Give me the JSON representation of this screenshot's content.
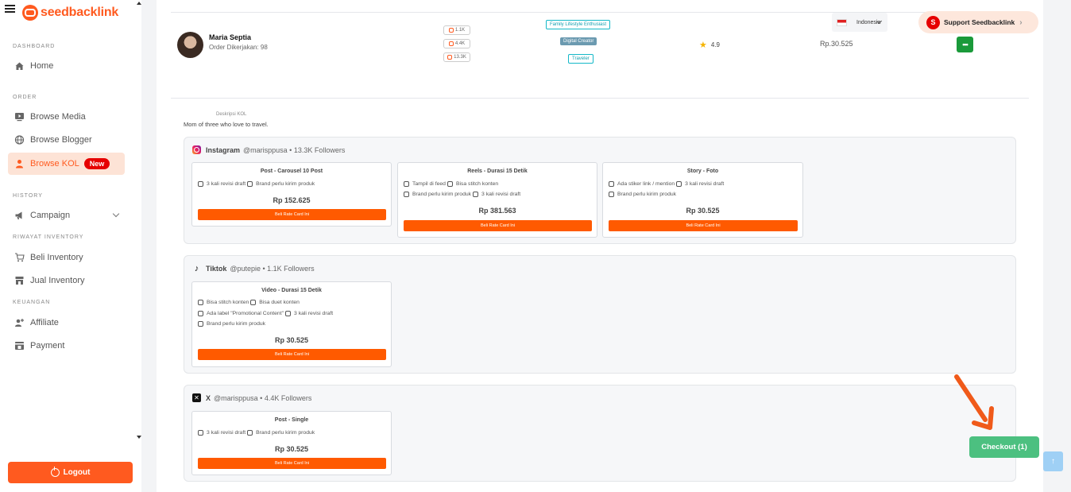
{
  "sidebar": {
    "brand": "seedbacklink",
    "sections": {
      "dashboard": "DASHBOARD",
      "order": "ORDER",
      "history": "HISTORY",
      "riwayat": "RIWAYAT INVENTORY",
      "keuangan": "KEUANGAN"
    },
    "items": {
      "home": "Home",
      "browse_media": "Browse Media",
      "browse_blogger": "Browse Blogger",
      "browse_kol": "Browse KOL",
      "browse_kol_badge": "New",
      "campaign": "Campaign",
      "beli_inventory": "Beli Inventory",
      "jual_inventory": "Jual Inventory",
      "affiliate": "Affiliate",
      "payment": "Payment"
    },
    "logout": "Logout"
  },
  "header": {
    "country": "Indonesia",
    "support": "Support Seedbacklink",
    "support_icon_letter": "S"
  },
  "kol": {
    "name": "Maria Septia",
    "orders": "Order Dikerjakan: 98",
    "stats": [
      "1.1K",
      "4.4K",
      "13.3K"
    ],
    "tags": [
      "Family Lifestyle Enthusiast",
      "Digital Creator",
      "Traveler"
    ],
    "rating": "4.9",
    "price": "Rp.30.525",
    "more": "•••",
    "desc_label": "Deskripsi KOL",
    "desc": "Mom of three who love to travel."
  },
  "platforms": {
    "instagram": {
      "name": "Instagram",
      "info": "@marisppusa • 13.3K Followers",
      "cards": [
        {
          "title": "Post - Carousel 10 Post",
          "rows": [
            [
              "3 kali revisi draft",
              "Brand perlu kirim produk"
            ]
          ],
          "price": "Rp 152.625",
          "btn": "Beli Rate Card Ini"
        },
        {
          "title": "Reels - Durasi 15 Detik",
          "rows": [
            [
              "Tampil di feed",
              "Bisa stitch konten"
            ],
            [
              "Brand perlu kirim produk",
              "3 kali revisi draft"
            ]
          ],
          "price": "Rp 381.563",
          "btn": "Beli Rate Card Ini"
        },
        {
          "title": "Story - Foto",
          "rows": [
            [
              "Ada stiker link / mention",
              "3 kali revisi draft"
            ],
            [
              "Brand perlu kirim produk"
            ]
          ],
          "price": "Rp 30.525",
          "btn": "Beli Rate Card Ini"
        }
      ]
    },
    "tiktok": {
      "name": "Tiktok",
      "info": "@putepie • 1.1K Followers",
      "cards": [
        {
          "title": "Video - Durasi 15 Detik",
          "rows": [
            [
              "Bisa stitch konten",
              "Bisa duet konten"
            ],
            [
              "Ada label \"Promotional Content\"",
              "3 kali revisi draft"
            ],
            [
              "Brand perlu kirim produk"
            ]
          ],
          "price": "Rp 30.525",
          "btn": "Beli Rate Card Ini"
        }
      ]
    },
    "x": {
      "name": "X",
      "info": "@marisppusa • 4.4K Followers",
      "cards": [
        {
          "title": "Post - Single",
          "rows": [
            [
              "3 kali revisi draft",
              "Brand perlu kirim produk"
            ]
          ],
          "price": "Rp 30.525",
          "btn": "Beli Rate Card Ini"
        }
      ]
    }
  },
  "checkout": "Checkout (1)",
  "colors": {
    "accent": "#ff5a1f",
    "success": "#4cc080",
    "danger": "#e60000"
  }
}
